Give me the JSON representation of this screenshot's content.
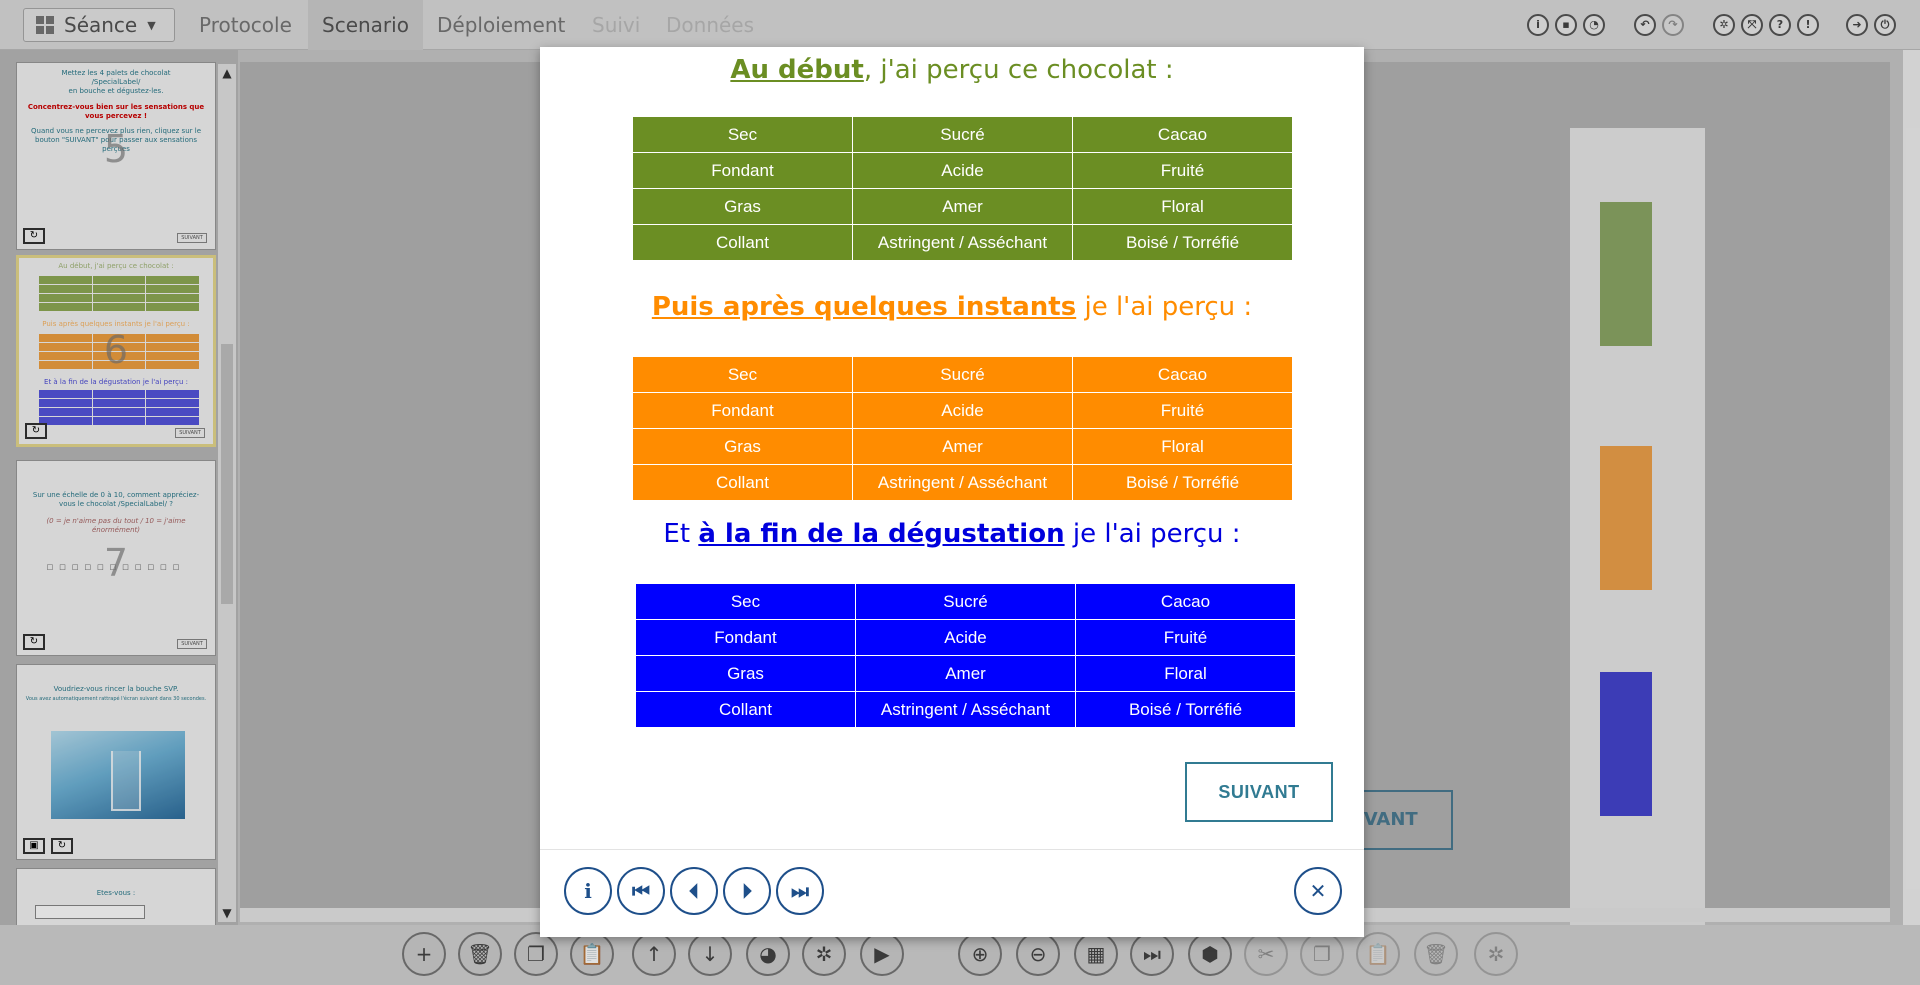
{
  "menu": {
    "seance_label": "Séance",
    "tabs": [
      {
        "label": "Protocole",
        "state": "normal"
      },
      {
        "label": "Scenario",
        "state": "active"
      },
      {
        "label": "Déploiement",
        "state": "normal"
      },
      {
        "label": "Suivi",
        "state": "disabled"
      },
      {
        "label": "Données",
        "state": "disabled"
      }
    ]
  },
  "thumbnails": [
    {
      "number": "5",
      "lines": [
        "Mettez les 4 palets de chocolat",
        "/SpecialLabel/",
        "en bouche et dégustez-les.",
        "Concentrez-vous bien sur les sensations que vous percevez !",
        "Quand vous ne percevez plus rien, cliquez sur le bouton \"SUIVANT\" pour passer aux sensations perçues"
      ],
      "button": "SUIVANT"
    },
    {
      "number": "6",
      "lines": [
        "Au début, j'ai perçu ce chocolat :",
        "Puis après quelques instants je l'ai perçu :",
        "Et à la fin de la dégustation je l'ai perçu :"
      ],
      "button": "SUIVANT"
    },
    {
      "number": "7",
      "lines": [
        "Sur une échelle de 0 à 10, comment appréciez-vous le chocolat /SpecialLabel/ ?",
        "(0 = je n'aime pas du tout / 10 = j'aime énormément)"
      ],
      "button": "SUIVANT"
    },
    {
      "number": "",
      "lines": [
        "Voudriez-vous rincer la bouche SVP.",
        "Vous avez automatiquement rattrapé l'écran suivant dans 30 secondes."
      ],
      "button": ""
    },
    {
      "number": "",
      "lines": [
        "Etes-vous :"
      ],
      "button": ""
    }
  ],
  "modal": {
    "section1": {
      "lead": "Au début",
      "rest": ", j'ai perçu ce chocolat :"
    },
    "section2": {
      "lead": "Puis après quelques instants",
      "rest": " je l'ai perçu :"
    },
    "section3": {
      "pre": "Et ",
      "lead": "à la fin de la dégustation",
      "rest": " je l'ai perçu :"
    },
    "rows": [
      [
        "Sec",
        "Sucré",
        "Cacao"
      ],
      [
        "Fondant",
        "Acide",
        "Fruité"
      ],
      [
        "Gras",
        "Amer",
        "Floral"
      ],
      [
        "Collant",
        "Astringent / Asséchant",
        "Boisé / Torréfié"
      ]
    ],
    "next_label": "SUIVANT",
    "nav": {
      "info": "i",
      "first": "⏮",
      "prev": "⏴",
      "next": "⏵",
      "last": "⏭",
      "close": "✕"
    }
  },
  "background": {
    "next_label": "IVANT"
  },
  "colors": {
    "green": "#6b8e23",
    "orange": "#ff8c00",
    "blue": "#0000ff",
    "accent": "#317b92"
  }
}
